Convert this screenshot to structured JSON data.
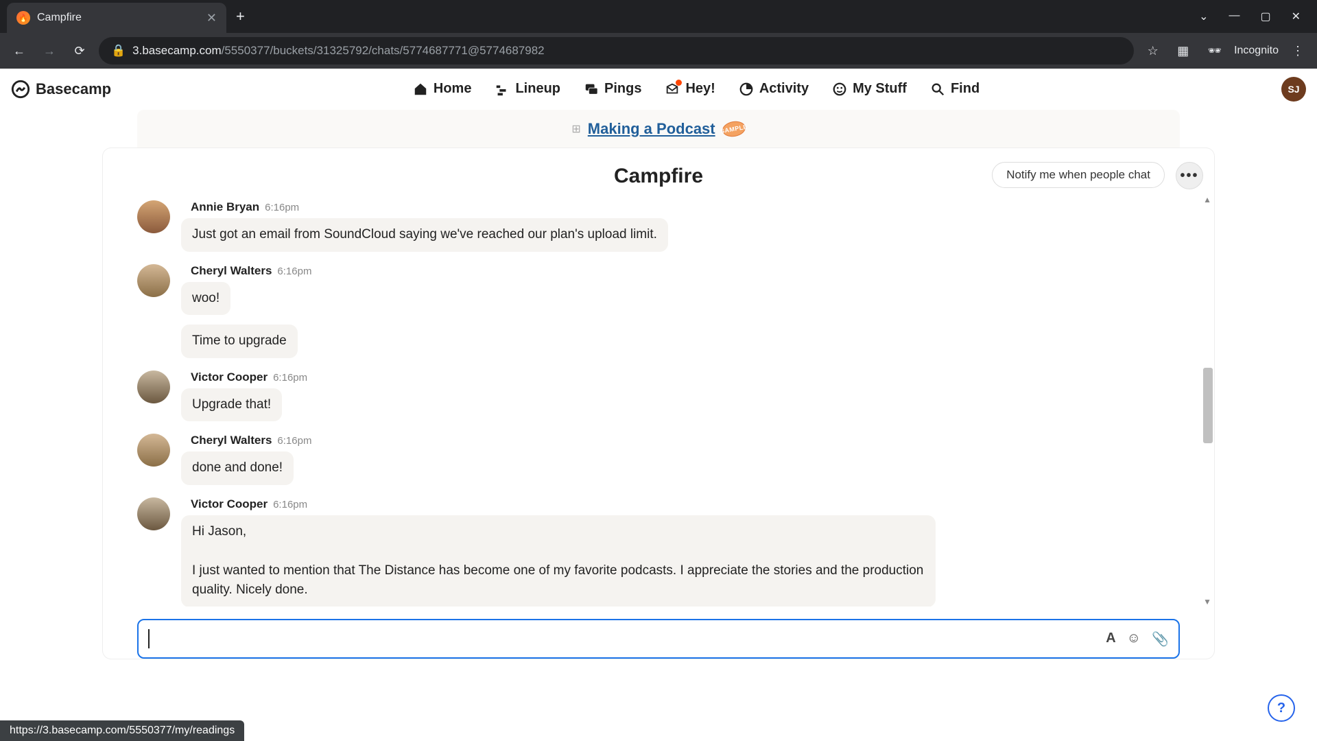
{
  "browser": {
    "tab_title": "Campfire",
    "url_host": "3.basecamp.com",
    "url_path": "/5550377/buckets/31325792/chats/5774687771@5774687982",
    "incognito": "Incognito",
    "status_url": "https://3.basecamp.com/5550377/my/readings"
  },
  "logo_text": "Basecamp",
  "nav": {
    "home": "Home",
    "lineup": "Lineup",
    "pings": "Pings",
    "hey": "Hey!",
    "activity": "Activity",
    "mystuff": "My Stuff",
    "find": "Find"
  },
  "avatar_initials": "SJ",
  "project": {
    "name": "Making a Podcast",
    "badge": "SAMPLE"
  },
  "page": {
    "title": "Campfire",
    "notify_label": "Notify me when people chat",
    "more": "•••"
  },
  "messages": [
    {
      "author": "Annie Bryan",
      "time": "6:16pm",
      "bubbles": [
        "Just got an email from SoundCloud saying we've reached our plan's upload limit."
      ],
      "avatar": "av-annie"
    },
    {
      "author": "Cheryl Walters",
      "time": "6:16pm",
      "bubbles": [
        "woo!",
        "Time to upgrade"
      ],
      "avatar": "av-cheryl"
    },
    {
      "author": "Victor Cooper",
      "time": "6:16pm",
      "bubbles": [
        "Upgrade that!"
      ],
      "avatar": "av-victor"
    },
    {
      "author": "Cheryl Walters",
      "time": "6:16pm",
      "bubbles": [
        "done and done!"
      ],
      "avatar": "av-cheryl"
    },
    {
      "author": "Victor Cooper",
      "time": "6:16pm",
      "bubbles": [
        "Hi Jason,\n\nI just wanted to mention that The Distance has become one of my favorite podcasts. I appreciate the stories and the production quality. Nicely done."
      ],
      "avatar": "av-victor"
    }
  ],
  "compose": {
    "placeholder": ""
  }
}
